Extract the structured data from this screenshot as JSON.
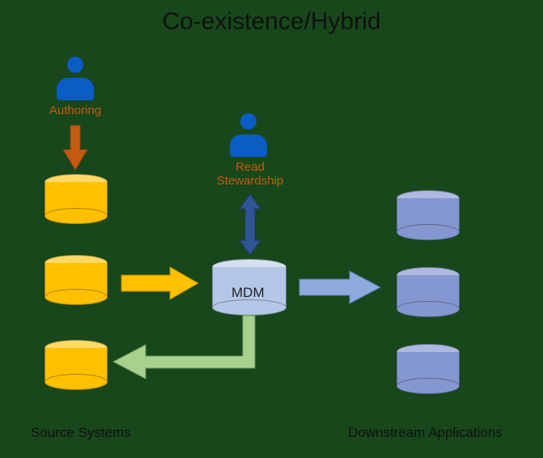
{
  "title": "Co-existence/Hybrid",
  "labels": {
    "authoring": "Authoring",
    "read_stewardship": "Read\nStewardship",
    "mdm": "MDM",
    "source_systems": "Source Systems",
    "downstream": "Downstream Applications"
  },
  "colors": {
    "source_cylinder": "#ffc000",
    "downstream_cylinder": "#8497d0",
    "mdm_cylinder": "#b4c7e7",
    "person": "#0b5cc4",
    "arrow_authoring": "#c55a11",
    "arrow_to_mdm": "#ffc000",
    "arrow_feedback": "#a9d18e",
    "arrow_bidir": "#2f5597",
    "arrow_out": "#8faadc",
    "label_orange": "#c65a11"
  },
  "entities": {
    "source_systems_count": 3,
    "downstream_count": 3,
    "hubs": [
      "MDM"
    ]
  },
  "flows": [
    {
      "from": "authoring-user",
      "to": "source-system-1",
      "dir": "down",
      "style": "orange"
    },
    {
      "from": "source-system-2",
      "to": "mdm",
      "dir": "right",
      "style": "yellow"
    },
    {
      "from": "mdm",
      "to": "source-system-3",
      "dir": "left-down",
      "style": "green"
    },
    {
      "from": "read-steward-user",
      "to": "mdm",
      "dir": "bidir",
      "style": "darkblue"
    },
    {
      "from": "mdm",
      "to": "downstream-2",
      "dir": "right",
      "style": "lightblue"
    }
  ]
}
